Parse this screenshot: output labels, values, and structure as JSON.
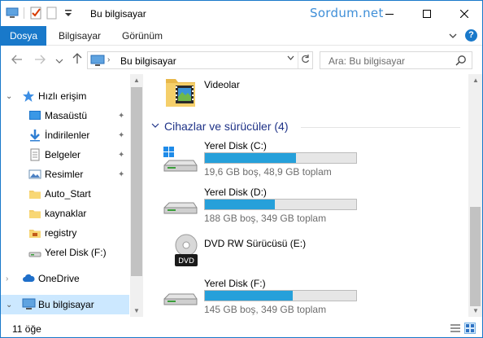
{
  "window": {
    "title": "Bu bilgisayar",
    "watermark": "Sordum.net",
    "accent": "#1979ca"
  },
  "ribbon": {
    "tabs": [
      "Dosya",
      "Bilgisayar",
      "Görünüm"
    ],
    "help": "?"
  },
  "address": {
    "path": "Bu bilgisayar",
    "search_placeholder": "Ara: Bu bilgisayar"
  },
  "nav": {
    "items": [
      {
        "label": "Hızlı erişim",
        "icon": "star-icon",
        "pinned": false
      },
      {
        "label": "Masaüstü",
        "icon": "desktop-icon",
        "pinned": true
      },
      {
        "label": "İndirilenler",
        "icon": "download-arrow-icon",
        "pinned": true
      },
      {
        "label": "Belgeler",
        "icon": "documents-icon",
        "pinned": true
      },
      {
        "label": "Resimler",
        "icon": "pictures-icon",
        "pinned": true
      },
      {
        "label": "Auto_Start",
        "icon": "folder-icon",
        "pinned": false
      },
      {
        "label": "kaynaklar",
        "icon": "folder-icon",
        "pinned": false
      },
      {
        "label": "registry",
        "icon": "registry-folder-icon",
        "pinned": false
      },
      {
        "label": "Yerel Disk (F:)",
        "icon": "drive-icon",
        "pinned": false
      },
      {
        "label": "OneDrive",
        "icon": "cloud-icon",
        "pinned": false
      },
      {
        "label": "Bu bilgisayar",
        "icon": "computer-icon",
        "pinned": false
      }
    ]
  },
  "content": {
    "folder": {
      "label": "Videolar",
      "icon": "videos-folder-icon"
    },
    "group_title": "Cihazlar ve sürücüler (4)",
    "drives": [
      {
        "name": "Yerel Disk (C:)",
        "detail": "19,6 GB boş, 48,9 GB toplam",
        "used_fraction": 0.6,
        "icon": "windows-drive-icon"
      },
      {
        "name": "Yerel Disk (D:)",
        "detail": "188 GB boş, 349 GB toplam",
        "used_fraction": 0.46,
        "icon": "drive-icon"
      },
      {
        "name": "DVD RW Sürücüsü (E:)",
        "detail": "",
        "used_fraction": null,
        "icon": "dvd-drive-icon",
        "dvd_label": "DVD"
      },
      {
        "name": "Yerel Disk (F:)",
        "detail": "145 GB boş, 349 GB toplam",
        "used_fraction": 0.58,
        "icon": "drive-icon"
      }
    ]
  },
  "status": {
    "count": "11 öğe"
  }
}
